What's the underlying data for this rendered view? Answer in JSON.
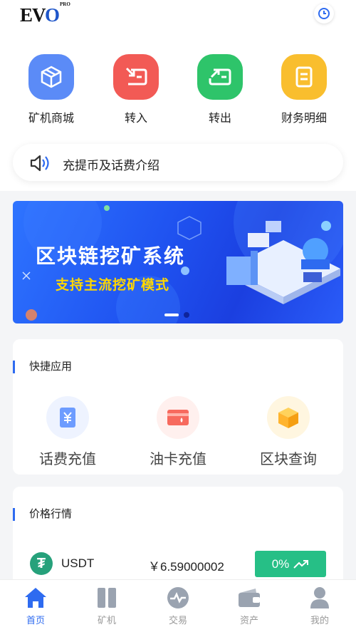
{
  "header": {
    "logo_text": "EVO",
    "logo_sup": "PRO"
  },
  "actions": [
    {
      "label": "矿机商城",
      "icon": "cube-icon",
      "color": "#5b8bf7"
    },
    {
      "label": "转入",
      "icon": "transfer-in-icon",
      "color": "#f25a55"
    },
    {
      "label": "转出",
      "icon": "transfer-out-icon",
      "color": "#2ec46a"
    },
    {
      "label": "财务明细",
      "icon": "ledger-icon",
      "color": "#f9be2e"
    }
  ],
  "notice": {
    "text": "充提币及话费介绍",
    "icon": "speaker-icon"
  },
  "banner": {
    "title": "区块链挖矿系统",
    "subtitle": "支持主流挖矿模式"
  },
  "quick_apps": {
    "title": "快捷应用",
    "items": [
      {
        "label": "话费充值",
        "icon": "yen-card-icon"
      },
      {
        "label": "油卡充值",
        "icon": "fuel-card-icon"
      },
      {
        "label": "区块查询",
        "icon": "block-cube-icon"
      }
    ]
  },
  "market": {
    "title": "价格行情",
    "rows": [
      {
        "symbol": "USDT",
        "price": "￥6.59000002",
        "change": "0%",
        "icon": "tether-icon"
      }
    ]
  },
  "tabbar": [
    {
      "label": "首页",
      "icon": "home-icon",
      "active": true
    },
    {
      "label": "矿机",
      "icon": "miner-icon",
      "active": false
    },
    {
      "label": "交易",
      "icon": "trade-icon",
      "active": false
    },
    {
      "label": "资产",
      "icon": "wallet-icon",
      "active": false
    },
    {
      "label": "我的",
      "icon": "user-icon",
      "active": false
    }
  ],
  "colors": {
    "accent": "#2e6bf0",
    "up": "#26bf86",
    "inactive": "#999999"
  }
}
